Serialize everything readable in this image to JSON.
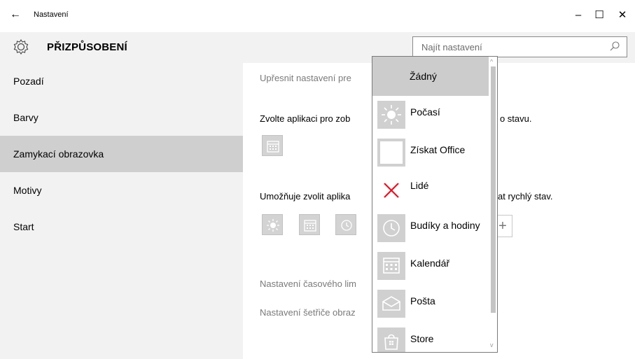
{
  "window": {
    "title": "Nastavení",
    "back_glyph": "←",
    "minimize_glyph": "–",
    "maximize_glyph": "☐",
    "close_glyph": "✕"
  },
  "header": {
    "heading": "PŘIZPŮSOBENÍ",
    "search_placeholder": "Najít nastavení"
  },
  "sidebar": {
    "items": [
      {
        "label": "Pozadí"
      },
      {
        "label": "Barvy"
      },
      {
        "label": "Zamykací obrazovka",
        "selected": true
      },
      {
        "label": "Motivy"
      },
      {
        "label": "Start"
      }
    ]
  },
  "content": {
    "line1": "Upřesnit nastavení pre",
    "line2a": "Zvolte aplikaci pro zob",
    "line2b": "ací o stavu.",
    "line3a": "Umožňuje zvolit aplika",
    "line3b": "at rychlý stav.",
    "plus": "+",
    "link1": "Nastavení časového lim",
    "link2": "Nastavení šetřiče obraz"
  },
  "dropdown": {
    "items": [
      {
        "label": "Žádný",
        "selected": true
      },
      {
        "label": "Počasí",
        "icon": "weather-sun-icon"
      },
      {
        "label": "Získat Office",
        "icon": "office-icon"
      },
      {
        "label": "Lidé",
        "icon": "people-x-icon"
      },
      {
        "label": "Budíky a hodiny",
        "icon": "alarm-clock-icon"
      },
      {
        "label": "Kalendář",
        "icon": "calendar-icon"
      },
      {
        "label": "Pošta",
        "icon": "mail-icon"
      },
      {
        "label": "Store",
        "icon": "store-icon"
      }
    ],
    "scroll_up": "^",
    "scroll_down": "v"
  },
  "colors": {
    "sidebar_bg": "#f2f2f2",
    "selected_bg": "#cfcfcf",
    "tile_bg": "#d3d3d3",
    "people_x": "#e81123"
  }
}
